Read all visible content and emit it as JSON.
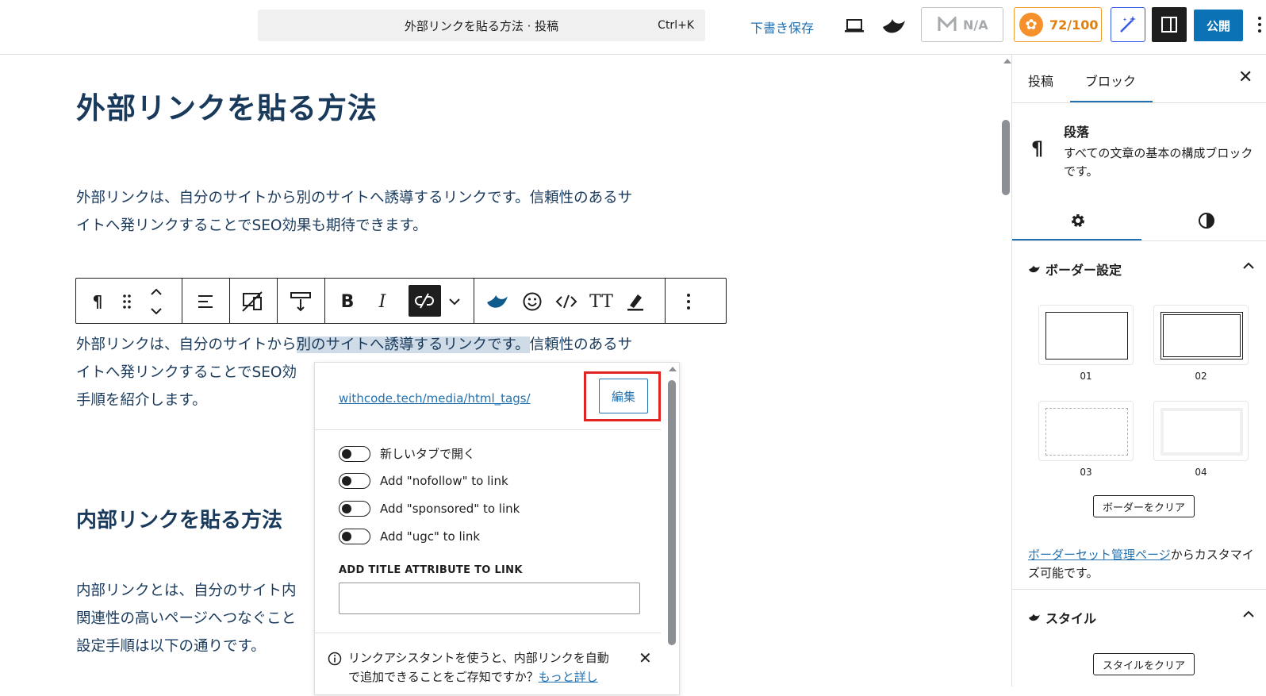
{
  "topbar": {
    "command_title": "外部リンクを貼る方法 · 投稿",
    "command_shortcut": "Ctrl+K",
    "save_draft": "下書き保存",
    "seo_na": "N/A",
    "score": "72/100",
    "publish": "公開",
    "icons": [
      "laptop-icon",
      "swell-icon",
      "seo-m-icon",
      "score-coin-icon",
      "ai-wand-icon",
      "sidebar-toggle-icon",
      "more-vertical-icon"
    ]
  },
  "editor": {
    "title": "外部リンクを貼る方法",
    "para1_line1": "外部リンクは、自分のサイトから別のサイトへ誘導するリンクです。信頼性のあるサ",
    "para1_line2": "イトへ発リンクすることでSEO効果も期待できます。",
    "para2_line1_a": "外部リンクは、自分のサイトから",
    "para2_line1_hl": "別のサイトへ誘導するリンクです。",
    "para2_line1_b": "信頼性のあるサ",
    "para2_line2": "イトへ発リンクすることでSEO効",
    "para2_line3": "手順を紹介します。",
    "heading2": "内部リンクを貼る方法",
    "para3_line1": "内部リンクとは、自分のサイト内",
    "para3_line2": "関連性の高いページへつなぐこと",
    "para3_line3": "設定手順は以下の通りです。"
  },
  "link_popover": {
    "url": "withcode.tech/media/html_tags/",
    "edit": "編集",
    "options": [
      {
        "label": "新しいタブで開く",
        "on": false
      },
      {
        "label": "Add \"nofollow\" to link",
        "on": false
      },
      {
        "label": "Add \"sponsored\" to link",
        "on": false
      },
      {
        "label": "Add \"ugc\" to link",
        "on": false
      }
    ],
    "title_attr_label": "ADD TITLE ATTRIBUTE TO LINK",
    "title_attr_value": "",
    "notice_line1": "リンクアシスタントを使うと、内部リンクを自動",
    "notice_line2": "で追加できることをご存知ですか？",
    "notice_link": "もっと詳し"
  },
  "sidebar": {
    "tab_post": "投稿",
    "tab_block": "ブロック",
    "block_name": "段落",
    "block_desc": "すべての文章の基本の構成ブロックです。",
    "border_section": "ボーダー設定",
    "border_captions": [
      "01",
      "02",
      "03",
      "04"
    ],
    "border_clear": "ボーダーをクリア",
    "note_link": "ボーダーセット管理ページ",
    "note_rest": "からカスタマイズ可能です。",
    "style_section": "スタイル",
    "style_clear": "スタイルをクリア"
  },
  "colors": {
    "accent": "#2271b1",
    "publish": "#0a72b5",
    "heading_text": "#1a3a5c",
    "score": "#e0800b",
    "highlight_box": "#e02424"
  }
}
